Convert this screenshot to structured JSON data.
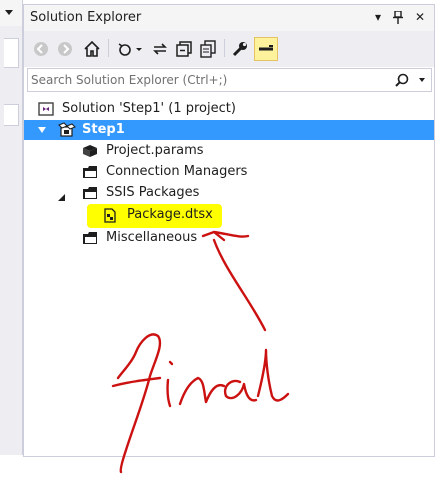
{
  "panel": {
    "title": "Solution Explorer",
    "title_buttons": [
      "▾",
      "⊐",
      "✕"
    ]
  },
  "toolbar": {
    "icons": [
      "back-icon",
      "forward-icon",
      "home-icon",
      "pending-changes-icon",
      "sync-icon",
      "collapse-all-icon",
      "show-all-files-icon",
      "properties-icon",
      "preview-icon"
    ]
  },
  "search": {
    "placeholder": "Search Solution Explorer (Ctrl+;)",
    "icon": "search-icon"
  },
  "tree": {
    "solution": "Solution 'Step1' (1 project)",
    "project": "Step1",
    "items": {
      "project_params": "Project.params",
      "connection_managers": "Connection Managers",
      "ssis_packages": "SSIS Packages",
      "package": "Package.dtsx",
      "miscellaneous": "Miscellaneous"
    }
  },
  "annotation": {
    "handwriting": "final",
    "highlight_color": "#ffff00",
    "ink_color": "#cc1111"
  },
  "colors": {
    "selection": "#3399ff",
    "toolbar_bg": "#eeeef2",
    "title_bg": "#f5f5f5"
  }
}
